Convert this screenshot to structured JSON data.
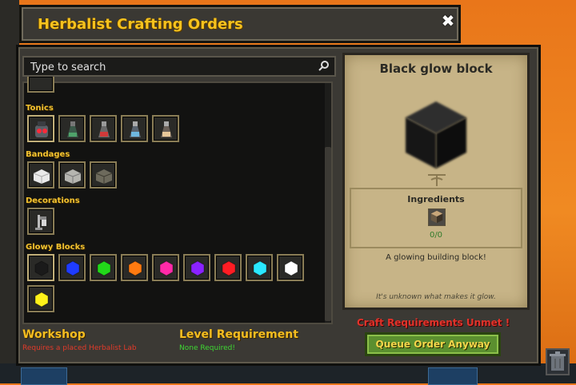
{
  "window": {
    "title": "Herbalist Crafting Orders",
    "close_icon": "✖"
  },
  "search": {
    "placeholder": "Type to search",
    "icon": "search-icon"
  },
  "categories": [
    {
      "label": "Tonics",
      "items": [
        "red-eyed tonic",
        "green tonic flask",
        "red tonic flask",
        "blue tonic flask",
        "tan tonic flask"
      ]
    },
    {
      "label": "Bandages",
      "items": [
        "white bandage",
        "gray bandage",
        "dark bandage"
      ]
    },
    {
      "label": "Decorations",
      "items": [
        "lantern decoration"
      ]
    },
    {
      "label": "Glowy Blocks",
      "items": [
        {
          "name": "black glow block",
          "color": "#1a1a1a"
        },
        {
          "name": "blue glow block",
          "color": "#1f3cff"
        },
        {
          "name": "green glow block",
          "color": "#22d81a"
        },
        {
          "name": "orange glow block",
          "color": "#ff7a10"
        },
        {
          "name": "pink glow block",
          "color": "#ff2aa8"
        },
        {
          "name": "purple glow block",
          "color": "#8a22ff"
        },
        {
          "name": "red glow block",
          "color": "#ff1d24"
        },
        {
          "name": "cyan glow block",
          "color": "#2ae8ff"
        },
        {
          "name": "white glow block",
          "color": "#ffffff"
        },
        {
          "name": "yellow glow block",
          "color": "#fff21a"
        }
      ]
    }
  ],
  "detail": {
    "title": "Black glow block",
    "ingredients_label": "Ingredients",
    "ingredient_count": "0/0",
    "description": "A glowing building block!",
    "flavor": "It's unknown what makes it glow."
  },
  "requirements": {
    "workshop_title": "Workshop",
    "workshop_status": "Requires a placed Herbalist Lab",
    "workshop_color": "#e23a2a",
    "level_title": "Level Requirement",
    "level_status": "None Required!",
    "level_color": "#3ed832",
    "unmet_text": "Craft Requirements Unmet !",
    "queue_button": "Queue Order Anyway"
  }
}
